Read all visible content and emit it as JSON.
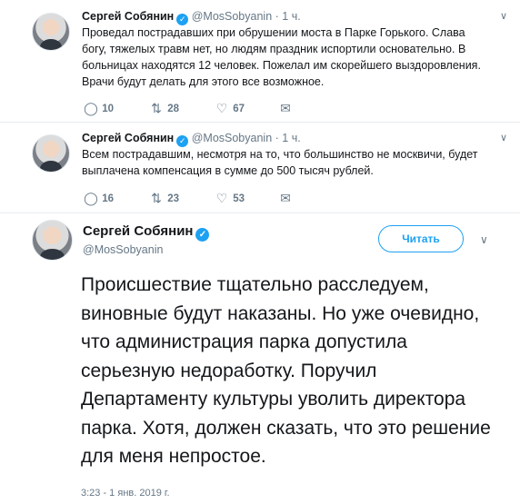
{
  "tweets": [
    {
      "name": "Сергей Собянин",
      "verified_glyph": "✓",
      "handle": "@MosSobyanin",
      "separator": "·",
      "time": "1 ч.",
      "text": "Проведал пострадавших при обрушении моста в Парке Горького. Слава богу, тяжелых травм нет, но людям праздник испортили основательно. В больницах находятся 12 человек. Пожелал им скорейшего выздоровления. Врачи будут делать для этого все возможное.",
      "replies": "10",
      "retweets": "28",
      "likes": "67"
    },
    {
      "name": "Сергей Собянин",
      "verified_glyph": "✓",
      "handle": "@MosSobyanin",
      "separator": "·",
      "time": "1 ч.",
      "text": "Всем пострадавшим, несмотря на то, что большинство не москвичи, будет выплачена компенсация в сумме до 500 тысяч рублей.",
      "replies": "16",
      "retweets": "23",
      "likes": "53"
    }
  ],
  "main": {
    "name": "Сергей Собянин",
    "verified_glyph": "✓",
    "handle": "@MosSobyanin",
    "follow_label": "Читать",
    "text": "Происшествие тщательно расследуем, виновные будут наказаны. Но уже очевидно, что администрация парка допустила серьезную недоработку. Поручил Департаменту культуры уволить директора парка. Хотя, должен сказать, что это решение для меня непростое.",
    "timestamp": "3:23 - 1 янв. 2019 г."
  },
  "icons": {
    "chevron": "∨",
    "reply": "◯",
    "retweet": "⇅",
    "like": "♡",
    "dm": "✉"
  },
  "colors": {
    "accent": "#1da1f2",
    "secondary_text": "#657786",
    "divider": "#e6ecf0"
  }
}
